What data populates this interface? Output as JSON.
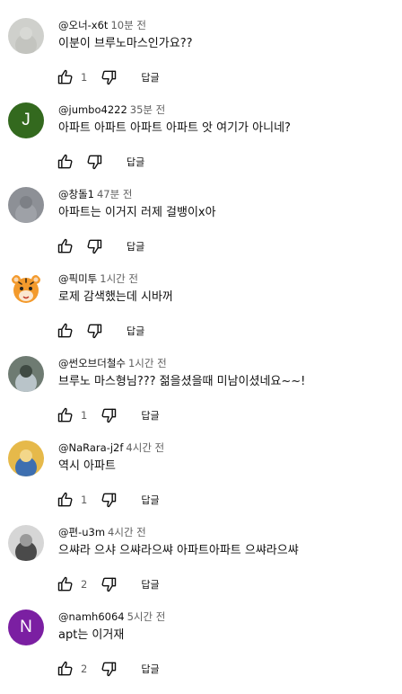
{
  "reply_label": "답글",
  "comments": [
    {
      "author": "@오너-x6t",
      "time": "10분 전",
      "text": "이분이 브루노마스인가요??",
      "likes": "1",
      "avatar": {
        "type": "photo",
        "palette": [
          "#cfd0cc",
          "#c3c4bf",
          "#d8d9d5"
        ]
      }
    },
    {
      "author": "@jumbo4222",
      "time": "35분 전",
      "text": "아파트 아파트 아파트 아파트 앗 여기가 아니네?",
      "likes": "",
      "avatar": {
        "type": "letter",
        "letter": "J",
        "color": "#33691e"
      }
    },
    {
      "author": "@창돌1",
      "time": "47분 전",
      "text": "아파트는 이거지 러제 걸뱅이x아",
      "likes": "",
      "avatar": {
        "type": "photo",
        "palette": [
          "#8d9096",
          "#9ea1a7",
          "#7d8086"
        ]
      }
    },
    {
      "author": "@픽미투",
      "time": "1시간 전",
      "text": "로제 감색했는데 시바꺼",
      "likes": "",
      "avatar": {
        "type": "tiger"
      }
    },
    {
      "author": "@썬오브더철수",
      "time": "1시간 전",
      "text": "브루노 마스형님??? 젊을셨을때 미남이셨네요~~!",
      "likes": "1",
      "avatar": {
        "type": "photo",
        "palette": [
          "#6e7b72",
          "#b9c4c9",
          "#3f4a43"
        ]
      }
    },
    {
      "author": "@NaRara-j2f",
      "time": "4시간 전",
      "text": "역시 아파트",
      "likes": "1",
      "avatar": {
        "type": "photo",
        "palette": [
          "#e6b94a",
          "#3e6fb0",
          "#f3d78a"
        ]
      }
    },
    {
      "author": "@편-u3m",
      "time": "4시간 전",
      "text": "으쌰라 으샤 으쌰라으쌰 아파트아파트 으쌰라으쌰",
      "likes": "2",
      "avatar": {
        "type": "photo",
        "palette": [
          "#d6d6d6",
          "#4a4a4a",
          "#9a9a9a"
        ]
      }
    },
    {
      "author": "@namh6064",
      "time": "5시간 전",
      "text": "apt는 이거재",
      "likes": "2",
      "avatar": {
        "type": "letter",
        "letter": "N",
        "color": "#7b1fa2"
      }
    }
  ]
}
